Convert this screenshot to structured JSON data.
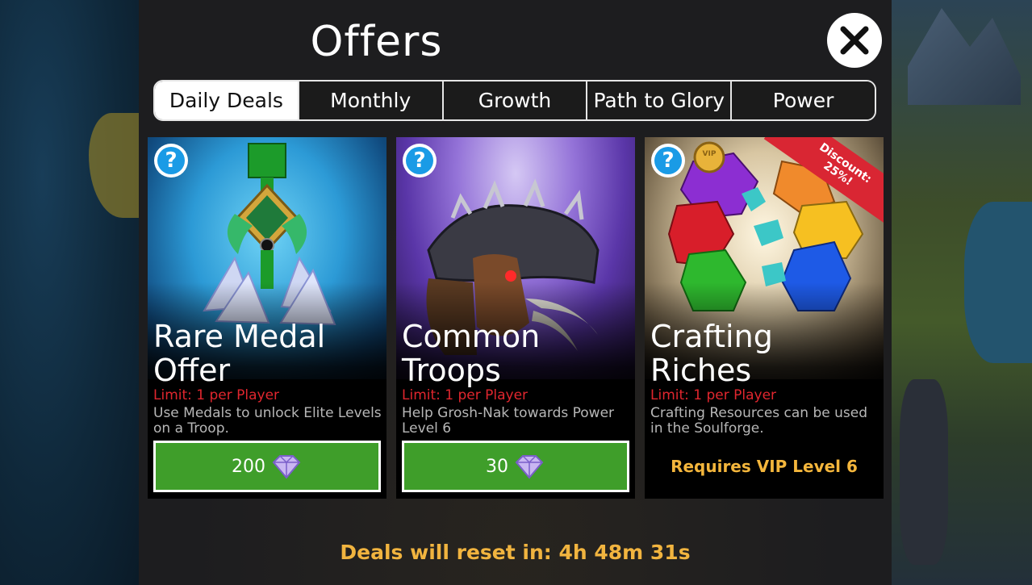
{
  "title": "Offers",
  "tabs": [
    {
      "label": "Daily Deals",
      "active": true
    },
    {
      "label": "Monthly",
      "active": false
    },
    {
      "label": "Growth",
      "active": false
    },
    {
      "label": "Path to Glory",
      "active": false
    },
    {
      "label": "Power",
      "active": false
    }
  ],
  "cards": [
    {
      "title": "Rare Medal Offer",
      "limit": "Limit: 1 per Player",
      "description": "Use Medals to unlock Elite Levels on a Troop.",
      "price": "200",
      "price_icon": "gem-icon"
    },
    {
      "title": "Common Troops",
      "limit": "Limit: 1 per Player",
      "description": "Help Grosh-Nak towards Power Level 6",
      "price": "30",
      "price_icon": "gem-icon"
    },
    {
      "title": "Crafting Riches",
      "limit": "Limit: 1 per Player",
      "description": "Crafting Resources can be used in the Soulforge.",
      "requirement": "Requires VIP Level 6",
      "discount": "Discount:\n25%!",
      "coin_label": "VIP"
    }
  ],
  "footer": "Deals will reset in: 4h 48m 31s",
  "colors": {
    "accent_green": "#3f9e2a",
    "limit_red": "#e0262e",
    "gold": "#f1b43f",
    "help_blue": "#1a9be6"
  }
}
